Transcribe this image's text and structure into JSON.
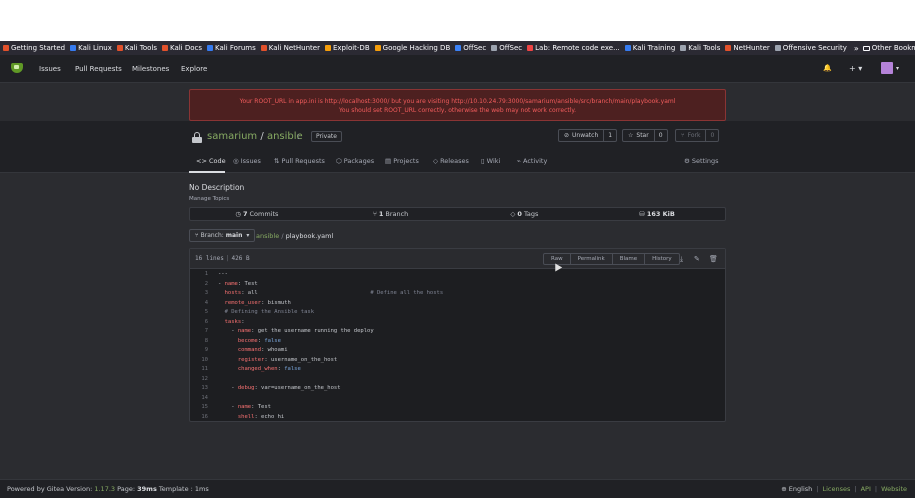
{
  "bookmarks": [
    {
      "label": "Getting Started",
      "color": "#e2512b"
    },
    {
      "label": "Kali Linux",
      "color": "#367bf0"
    },
    {
      "label": "Kali Tools",
      "color": "#e2512b"
    },
    {
      "label": "Kali Docs",
      "color": "#e2512b"
    },
    {
      "label": "Kali Forums",
      "color": "#367bf0"
    },
    {
      "label": "Kali NetHunter",
      "color": "#e2512b"
    },
    {
      "label": "Exploit-DB",
      "color": "#f59e0b"
    },
    {
      "label": "Google Hacking DB",
      "color": "#f59e0b"
    },
    {
      "label": "OffSec",
      "color": "#3b82f6"
    },
    {
      "label": "OffSec",
      "color": "#9ca3af"
    },
    {
      "label": "Lab: Remote code exe...",
      "color": "#ef4444"
    },
    {
      "label": "Kali Training",
      "color": "#367bf0"
    },
    {
      "label": "Kali Tools",
      "color": "#9ca3af"
    },
    {
      "label": "NetHunter",
      "color": "#e2512b"
    },
    {
      "label": "Offensive Security",
      "color": "#9ca3af"
    }
  ],
  "bookmarks_more": "»",
  "other_bookmarks": "Other Bookmarks",
  "nav": {
    "issues": "Issues",
    "pull_requests": "Pull Requests",
    "milestones": "Milestones",
    "explore": "Explore",
    "bell": "🔔",
    "plus": "+ ▾"
  },
  "error": {
    "line1": "Your ROOT_URL in app.ini is http://localhost:3000/ but you are visiting http://10.10.24.79:3000/samarium/ansible/src/branch/main/playbook.yaml",
    "line2": "You should set ROOT_URL correctly, otherwise the web may not work correctly."
  },
  "repo": {
    "owner": "samarium",
    "sep": "/",
    "name": "ansible",
    "rss": "⟟",
    "private": "Private",
    "watch_label": "Unwatch",
    "watch_count": "1",
    "star_label": "Star",
    "star_count": "0",
    "fork_label": "Fork",
    "fork_count": "0"
  },
  "tabs": {
    "code": "Code",
    "issues": "Issues",
    "pull_requests": "Pull Requests",
    "packages": "Packages",
    "projects": "Projects",
    "releases": "Releases",
    "wiki": "Wiki",
    "activity": "Activity",
    "settings": "Settings"
  },
  "description": "No Description",
  "manage_topics": "Manage Topics",
  "stats": {
    "commits_count": "7",
    "commits_label": "Commits",
    "branch_count": "1",
    "branch_label": "Branch",
    "tags_count": "0",
    "tags_label": "Tags",
    "size": "163 KiB"
  },
  "branch": {
    "prefix": "Branch:",
    "name": "main",
    "dir": "ansible",
    "sep": "/",
    "file": "playbook.yaml"
  },
  "file": {
    "lines": "16 lines",
    "size": "426 B",
    "raw": "Raw",
    "permalink": "Permalink",
    "blame": "Blame",
    "history": "History"
  },
  "code_lines": [
    {
      "n": "1",
      "text": "---"
    },
    {
      "n": "2",
      "text": "- name: Test"
    },
    {
      "n": "3",
      "text": "  hosts: all                                  # Define all the hosts"
    },
    {
      "n": "4",
      "text": "  remote_user: bismuth"
    },
    {
      "n": "5",
      "text": "  # Defining the Ansible task"
    },
    {
      "n": "6",
      "text": "  tasks:"
    },
    {
      "n": "7",
      "text": "    - name: get the username running the deploy"
    },
    {
      "n": "8",
      "text": "      become: false"
    },
    {
      "n": "9",
      "text": "      command: whoami"
    },
    {
      "n": "10",
      "text": "      register: username_on_the_host"
    },
    {
      "n": "11",
      "text": "      changed_when: false"
    },
    {
      "n": "12",
      "text": ""
    },
    {
      "n": "13",
      "text": "    - debug: var=username_on_the_host"
    },
    {
      "n": "14",
      "text": ""
    },
    {
      "n": "15",
      "text": "    - name: Test"
    },
    {
      "n": "16",
      "text": "      shell: echo hi"
    }
  ],
  "footer": {
    "powered": "Powered by Gitea Version:",
    "version": "1.17.3",
    "page_label": "Page:",
    "page_time": "39ms",
    "template_label": "Template :",
    "template_time": "1ms",
    "language": "English",
    "licenses": "Licenses",
    "api": "API",
    "website": "Website"
  }
}
